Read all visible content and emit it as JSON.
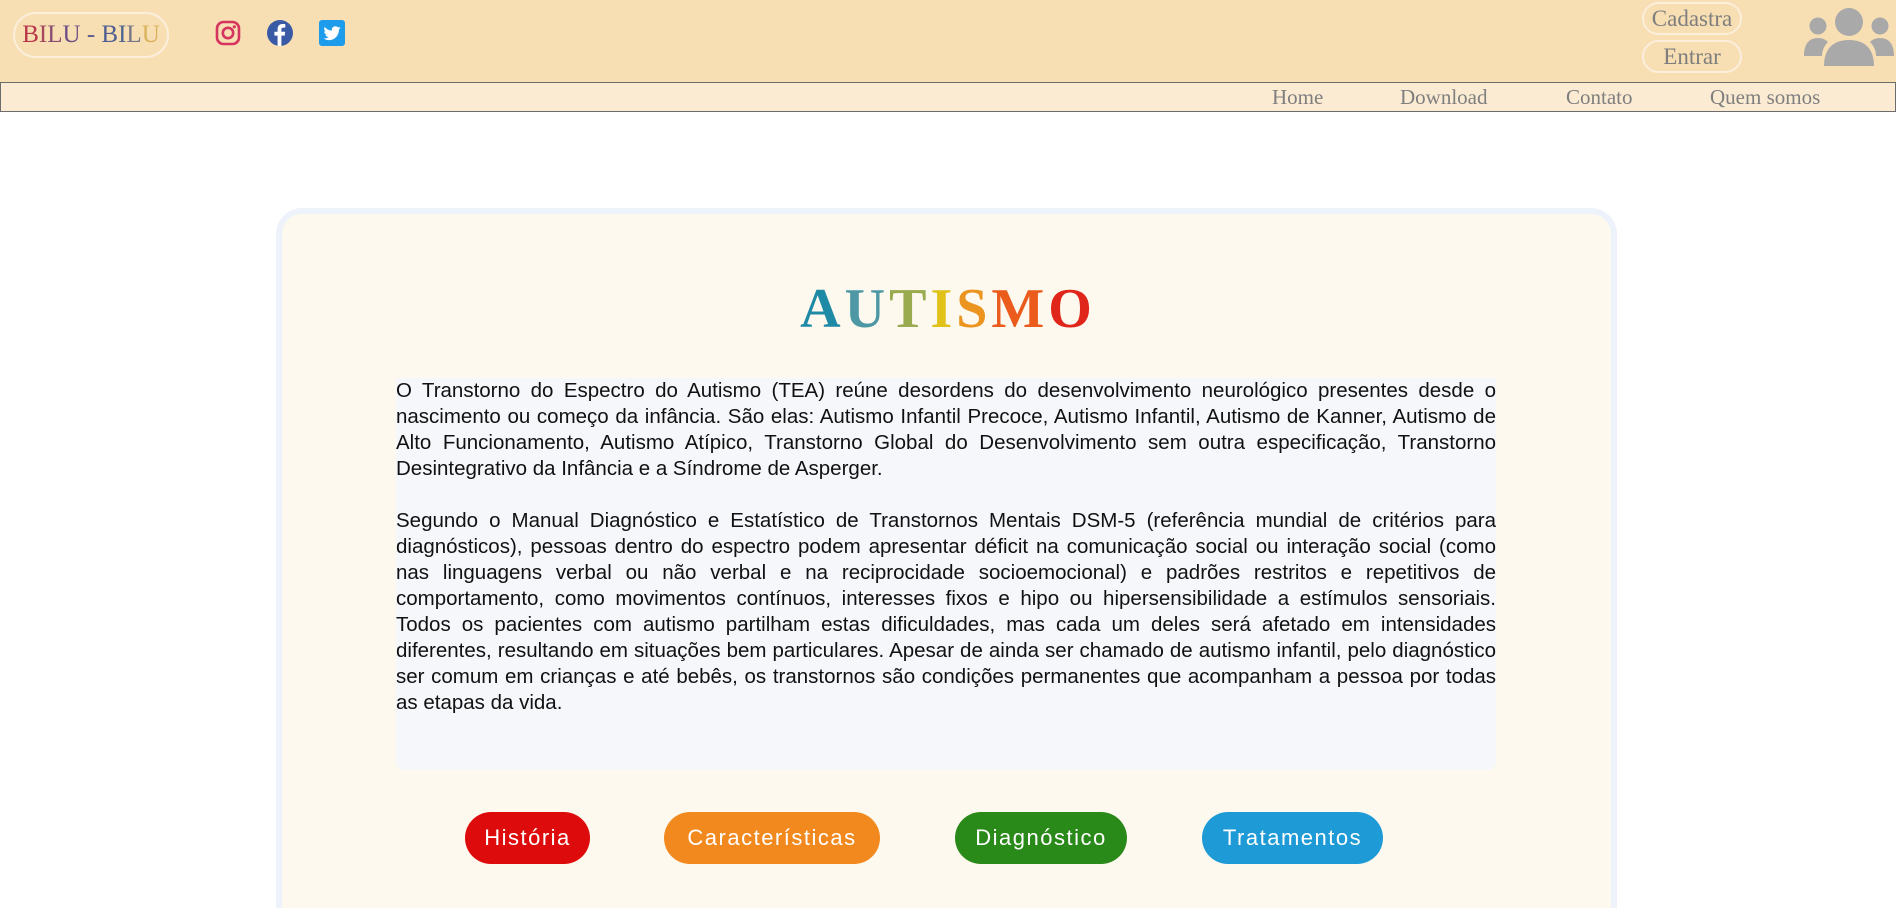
{
  "header": {
    "brand": {
      "segments": [
        {
          "text": "B",
          "color": "#b8374a"
        },
        {
          "text": "I",
          "color": "#a4475f"
        },
        {
          "text": "L",
          "color": "#8a4c73"
        },
        {
          "text": "U",
          "color": "#6e4f86"
        },
        {
          "text": " - ",
          "color": "#5d5a8e"
        },
        {
          "text": "B",
          "color": "#4e5e93"
        },
        {
          "text": "I",
          "color": "#4d6590"
        },
        {
          "text": "L",
          "color": "#76788a"
        },
        {
          "text": "U",
          "color": "#d9b25b"
        }
      ]
    },
    "social": [
      {
        "name": "instagram-icon",
        "color": "#d6335f"
      },
      {
        "name": "facebook-icon",
        "color": "#3b5aa6"
      },
      {
        "name": "twitter-icon",
        "color": "#1d9ceb"
      }
    ],
    "signup_label": "Cadastra",
    "login_label": "Entrar",
    "users_icon": "users-icon"
  },
  "nav": {
    "home": "Home",
    "download": "Download",
    "contato": "Contato",
    "quem_somos": "Quem somos"
  },
  "main": {
    "title_segments": [
      {
        "text": "A",
        "color": "#1f8aa6"
      },
      {
        "text": "U",
        "color": "#4d98a4"
      },
      {
        "text": "T",
        "color": "#9aaa4f"
      },
      {
        "text": "I",
        "color": "#e0c21a"
      },
      {
        "text": "S",
        "color": "#eb9420"
      },
      {
        "text": "M",
        "color": "#ea5b1c"
      },
      {
        "text": "O",
        "color": "#e0261b"
      }
    ],
    "paragraph_1": "O Transtorno do Espectro do Autismo (TEA) reúne desordens do desenvolvimento neurológico presentes desde o nascimento ou começo da infância. São elas: Autismo Infantil Precoce, Autismo Infantil, Autismo de Kanner, Autismo de Alto Funcionamento, Autismo Atípico, Transtorno Global do Desenvolvimento sem outra especificação, Transtorno Desintegrativo da Infância e a Síndrome de Asperger.",
    "paragraph_2": "Segundo o Manual Diagnóstico e Estatístico de Transtornos Mentais DSM-5 (referência mundial de critérios para diagnósticos), pessoas dentro do espectro podem apresentar déficit na comunicação social ou interação social (como nas linguagens verbal ou não verbal e na reciprocidade socioemocional) e padrões restritos e repetitivos de comportamento, como movimentos contínuos, interesses fixos e hipo ou hipersensibilidade a estímulos sensoriais. Todos os pacientes com autismo partilham estas dificuldades, mas cada um deles será afetado em intensidades diferentes, resultando em situações bem particulares. Apesar de ainda ser chamado de autismo infantil, pelo diagnóstico ser comum em crianças e até bebês, os transtornos são condições permanentes que acompanham a pessoa por todas as etapas da vida."
  },
  "categories": [
    {
      "label": "História",
      "color": "#dd0b0b"
    },
    {
      "label": "Características",
      "color": "#f2891f"
    },
    {
      "label": "Diagnóstico",
      "color": "#2a8a19"
    },
    {
      "label": "Tratamentos",
      "color": "#1e9ad6"
    }
  ],
  "colors": {
    "header_bg": "#f7dfb3",
    "nav_bg": "#fbebd3",
    "card_bg": "#fdf9ee",
    "nav_text": "#7f7f7f",
    "icon_gray": "#a9a9a9"
  }
}
